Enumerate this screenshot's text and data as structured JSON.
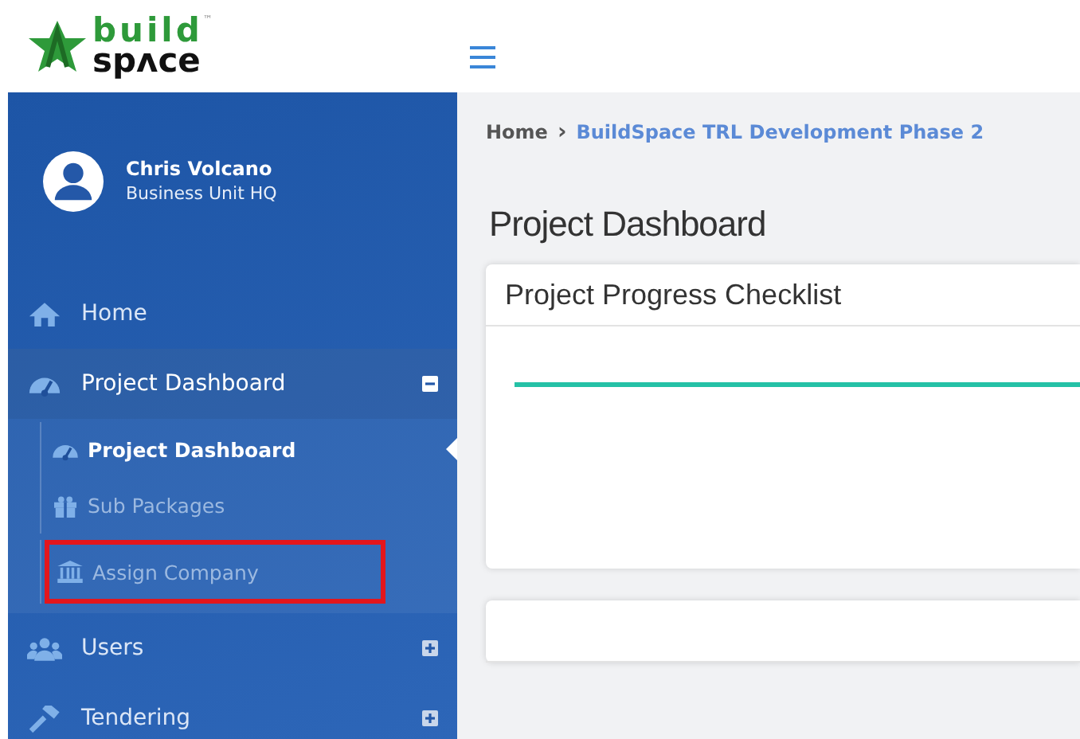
{
  "logo": {
    "top": "build",
    "bottom": "spʌce",
    "mark": "™"
  },
  "user": {
    "name": "Chris Volcano",
    "unit": "Business Unit HQ"
  },
  "menu": [
    {
      "label": "Home",
      "kind": "home"
    },
    {
      "label": "Project Dashboard",
      "kind": "gauge",
      "expanded": true,
      "children": [
        {
          "label": "Project Dashboard",
          "kind": "gauge",
          "selected": true,
          "highlighted": false
        },
        {
          "label": "Sub Packages",
          "kind": "gift",
          "selected": false,
          "highlighted": false
        },
        {
          "label": "Assign Company",
          "kind": "bank",
          "selected": false,
          "highlighted": true
        }
      ]
    },
    {
      "label": "Users",
      "kind": "users",
      "expanded": false
    },
    {
      "label": "Tendering",
      "kind": "gavel",
      "expanded": false
    }
  ],
  "breadcrumb": [
    {
      "label": "Home",
      "kind": "plain"
    },
    {
      "label": "›",
      "kind": "separator"
    },
    {
      "label": "BuildSpace TRL Development Phase 2",
      "kind": "link"
    }
  ],
  "page_title": "Project Dashboard",
  "cards": [
    {
      "title": "Project Progress Checklist",
      "kind": "progress"
    },
    {
      "kind": "empty"
    }
  ]
}
